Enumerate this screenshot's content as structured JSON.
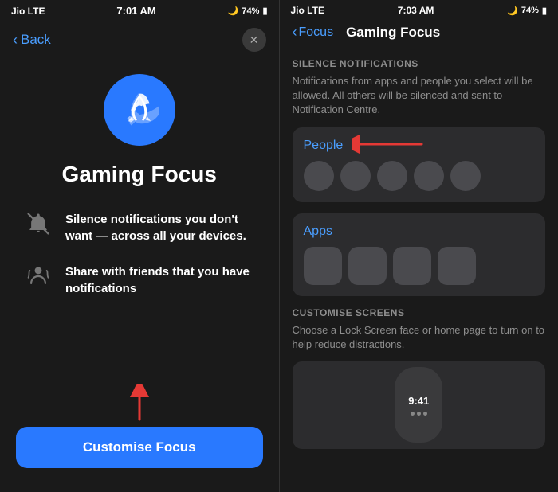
{
  "left": {
    "status": {
      "carrier": "Jio  LTE",
      "time": "7:01 AM",
      "battery": "74%"
    },
    "nav": {
      "back_label": "Back",
      "close_label": "✕"
    },
    "title": "Gaming Focus",
    "features": [
      {
        "id": "silence",
        "text": "Silence notifications you don't want — across all your devices."
      },
      {
        "id": "share",
        "text": "Share with friends that you have notifications"
      }
    ],
    "button_label": "Customise Focus"
  },
  "right": {
    "status": {
      "carrier": "Jio  LTE",
      "time": "7:03 AM",
      "battery": "74%"
    },
    "nav": {
      "back_label": "Focus",
      "title": "Gaming Focus"
    },
    "silence_section": {
      "heading": "SILENCE NOTIFICATIONS",
      "desc": "Notifications from apps and people you select will be allowed. All others will be silenced and sent to Notification Centre."
    },
    "people_label": "People",
    "apps_label": "Apps",
    "customise_section": {
      "heading": "CUSTOMISE SCREENS",
      "desc": "Choose a Lock Screen face or home page to turn on to help reduce distractions."
    },
    "lock_screen_time": "9:41"
  }
}
